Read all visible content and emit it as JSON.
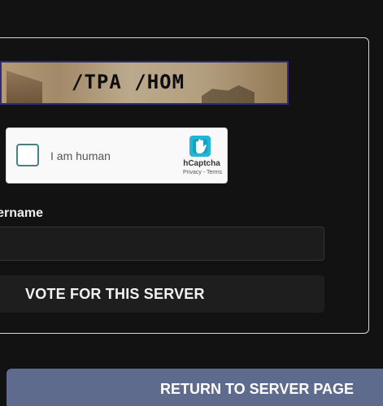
{
  "banner": {
    "text": "/TPA /HOM"
  },
  "captcha": {
    "checkbox_label": "I am human",
    "brand": "hCaptcha",
    "links": "Privacy - Terms",
    "logo_icon": "hcaptcha-hand-icon",
    "accent_color": "#1fb6d8"
  },
  "form": {
    "username_label": "Username",
    "username_value": "",
    "vote_button_label": "VOTE FOR THIS SERVER"
  },
  "footer": {
    "return_button_label": "RETURN TO SERVER PAGE",
    "return_button_color": "#5f6b8c"
  }
}
